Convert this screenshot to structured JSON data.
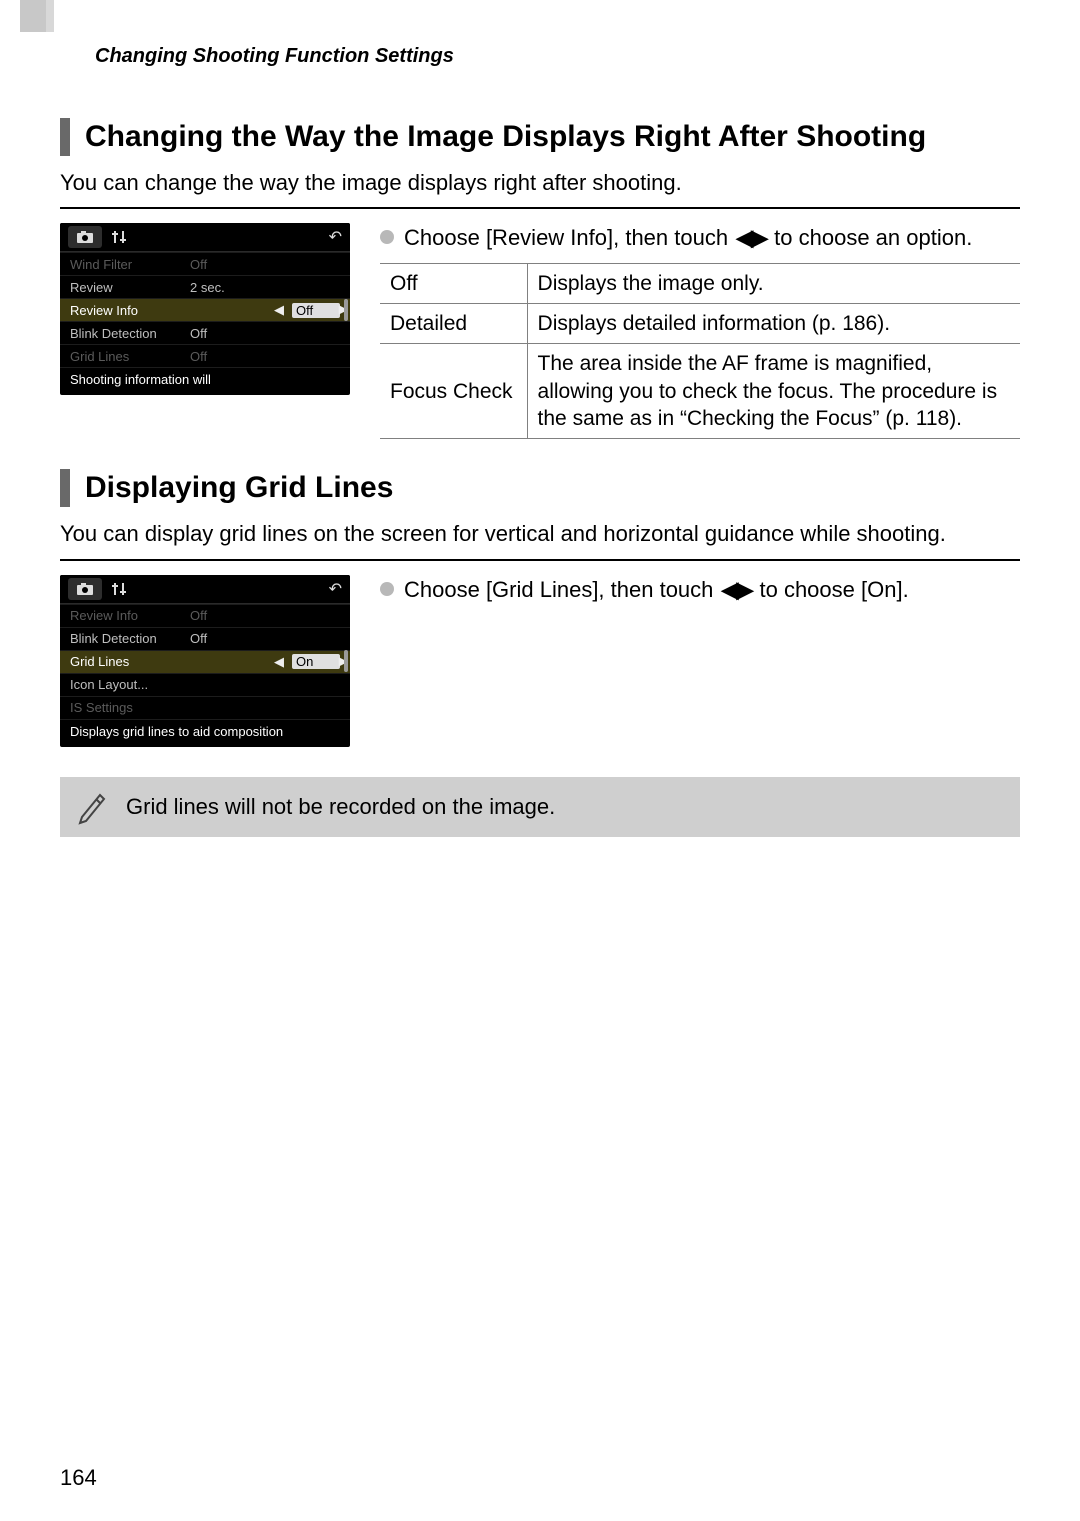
{
  "header": "Changing Shooting Function Settings",
  "sectionA": {
    "title": "Changing the Way the Image Displays Right After Shooting",
    "intro": "You can change the way the image displays right after shooting.",
    "instruction_pre": "Choose [Review Info], then touch ",
    "instruction_post": " to choose an option.",
    "table": [
      {
        "name": "Off",
        "desc": "Displays the image only."
      },
      {
        "name": "Detailed",
        "desc": "Displays detailed information (p. 186)."
      },
      {
        "name": "Focus Check",
        "desc": "The area inside the AF frame is magnified, allowing you to check the focus. The procedure is the same as in “Checking the Focus” (p. 118)."
      }
    ],
    "lcd": {
      "rows": [
        {
          "label": "Wind Filter",
          "value": "Off",
          "dim": true
        },
        {
          "label": "Review",
          "value": "2 sec.",
          "dim": false
        },
        {
          "label": "Review Info",
          "value": "Off",
          "selected": true
        },
        {
          "label": "Blink Detection",
          "value": "Off",
          "dim": false
        },
        {
          "label": "Grid Lines",
          "value": "Off",
          "dim": true
        }
      ],
      "footer": "Shooting information will"
    }
  },
  "sectionB": {
    "title": "Displaying Grid Lines",
    "intro": "You can display grid lines on the screen for vertical and horizontal guidance while shooting.",
    "instruction_pre": "Choose [Grid Lines], then touch ",
    "instruction_post": " to choose [On].",
    "lcd": {
      "rows": [
        {
          "label": "Review Info",
          "value": "Off",
          "dim": true
        },
        {
          "label": "Blink Detection",
          "value": "Off",
          "dim": false
        },
        {
          "label": "Grid Lines",
          "value": "On",
          "selected": true
        },
        {
          "label": "Icon Layout...",
          "value": "",
          "dim": false
        },
        {
          "label": "IS Settings",
          "value": "",
          "dim": true
        }
      ],
      "footer": "Displays grid lines to aid composition"
    }
  },
  "note": "Grid lines will not be recorded on the image.",
  "page_number": "164",
  "arrows_glyph": "◀▶"
}
